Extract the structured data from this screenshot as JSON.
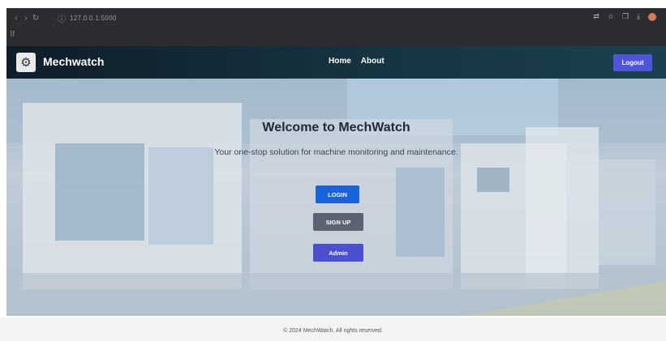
{
  "browser": {
    "nav_icons": [
      "back-icon",
      "forward-icon",
      "reload-icon"
    ],
    "nav_glyphs": [
      "‹",
      "›",
      "↻"
    ],
    "url": "127.0.0.1:5000",
    "info_glyph": "ⓘ",
    "apps_glyph": "⠿",
    "right_glyphs": [
      "⇄",
      "☆",
      "❐",
      "⤓"
    ]
  },
  "navbar": {
    "logo_glyph": "⚙",
    "brand": "Mechwatch",
    "links": [
      "Home",
      "About"
    ],
    "logout_label": "Logout"
  },
  "hero": {
    "title": "Welcome to MechWatch",
    "subtitle": "Your one-stop solution for machine monitoring and maintenance.",
    "login_label": "LOGIN",
    "signup_label": "SIGN UP",
    "admin_label": "Admin"
  },
  "footer": {
    "text": "© 2024 MechWatch. All rights reserved."
  },
  "colors": {
    "navbar_start": "#0f1d28",
    "navbar_end": "#1b4150",
    "login_button": "#1a63d9",
    "signup_button": "#5b6470",
    "admin_button": "#4b4fd0",
    "logout_button": "#4e55d8"
  }
}
